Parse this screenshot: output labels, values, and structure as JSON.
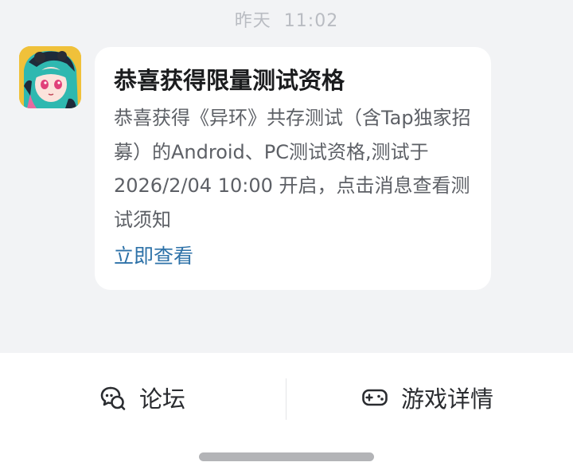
{
  "chat": {
    "timestamp_day": "昨天",
    "timestamp_time": "11:02",
    "avatar_icon": "game-character-avatar-icon"
  },
  "message": {
    "title": "恭喜获得限量测试资格",
    "body": "恭喜获得《异环》共存测试（含Tap独家招募）的Android、PC测试资格,测试于 2026/2/04 10:00 开启，点击消息查看测试须知",
    "link_label": "立即查看",
    "link_color": "#2e72a8"
  },
  "bottom_bar": {
    "forum_label": "论坛",
    "forum_icon": "chat-bubbles-icon",
    "game_label": "游戏详情",
    "game_icon": "gamepad-icon"
  },
  "colors": {
    "chat_background": "#f2f3f5",
    "bubble_background": "#ffffff",
    "avatar_background": "#f0c13a"
  }
}
